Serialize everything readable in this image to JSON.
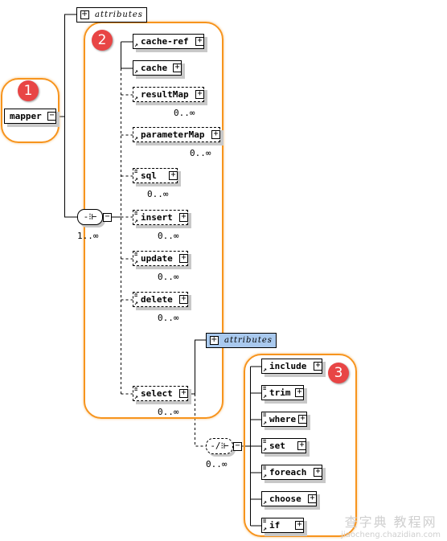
{
  "root": {
    "label": "mapper",
    "badge": "1"
  },
  "root_attributes": {
    "label": "attributes"
  },
  "root_sequence": {
    "icon": "sequence-icon",
    "multiplicity": "1..∞"
  },
  "group2": {
    "badge": "2",
    "elements": [
      {
        "label": "cache-ref",
        "optional": false,
        "multiplicity": ""
      },
      {
        "label": "cache",
        "optional": false,
        "multiplicity": ""
      },
      {
        "label": "resultMap",
        "optional": true,
        "multiplicity": "0..∞"
      },
      {
        "label": "parameterMap",
        "optional": true,
        "multiplicity": "0..∞"
      },
      {
        "label": "sql",
        "optional": true,
        "multiplicity": "0..∞"
      },
      {
        "label": "insert",
        "optional": true,
        "multiplicity": "0..∞"
      },
      {
        "label": "update",
        "optional": true,
        "multiplicity": "0..∞"
      },
      {
        "label": "delete",
        "optional": true,
        "multiplicity": "0..∞"
      },
      {
        "label": "select",
        "optional": true,
        "multiplicity": "0..∞"
      }
    ]
  },
  "select_attributes": {
    "label": "attributes",
    "selected": true
  },
  "select_choice": {
    "icon": "choice-icon",
    "multiplicity": "0..∞"
  },
  "group3": {
    "badge": "3",
    "elements": [
      {
        "label": "include"
      },
      {
        "label": "trim"
      },
      {
        "label": "where"
      },
      {
        "label": "set"
      },
      {
        "label": "foreach"
      },
      {
        "label": "choose"
      },
      {
        "label": "if"
      }
    ]
  },
  "watermark": {
    "line1": "查字典 教程网",
    "line2": "jiaocheng.chazidian.com"
  },
  "colors": {
    "highlight": "#f7941d",
    "badge": "#e84545",
    "selected": "#a9c9ee"
  }
}
